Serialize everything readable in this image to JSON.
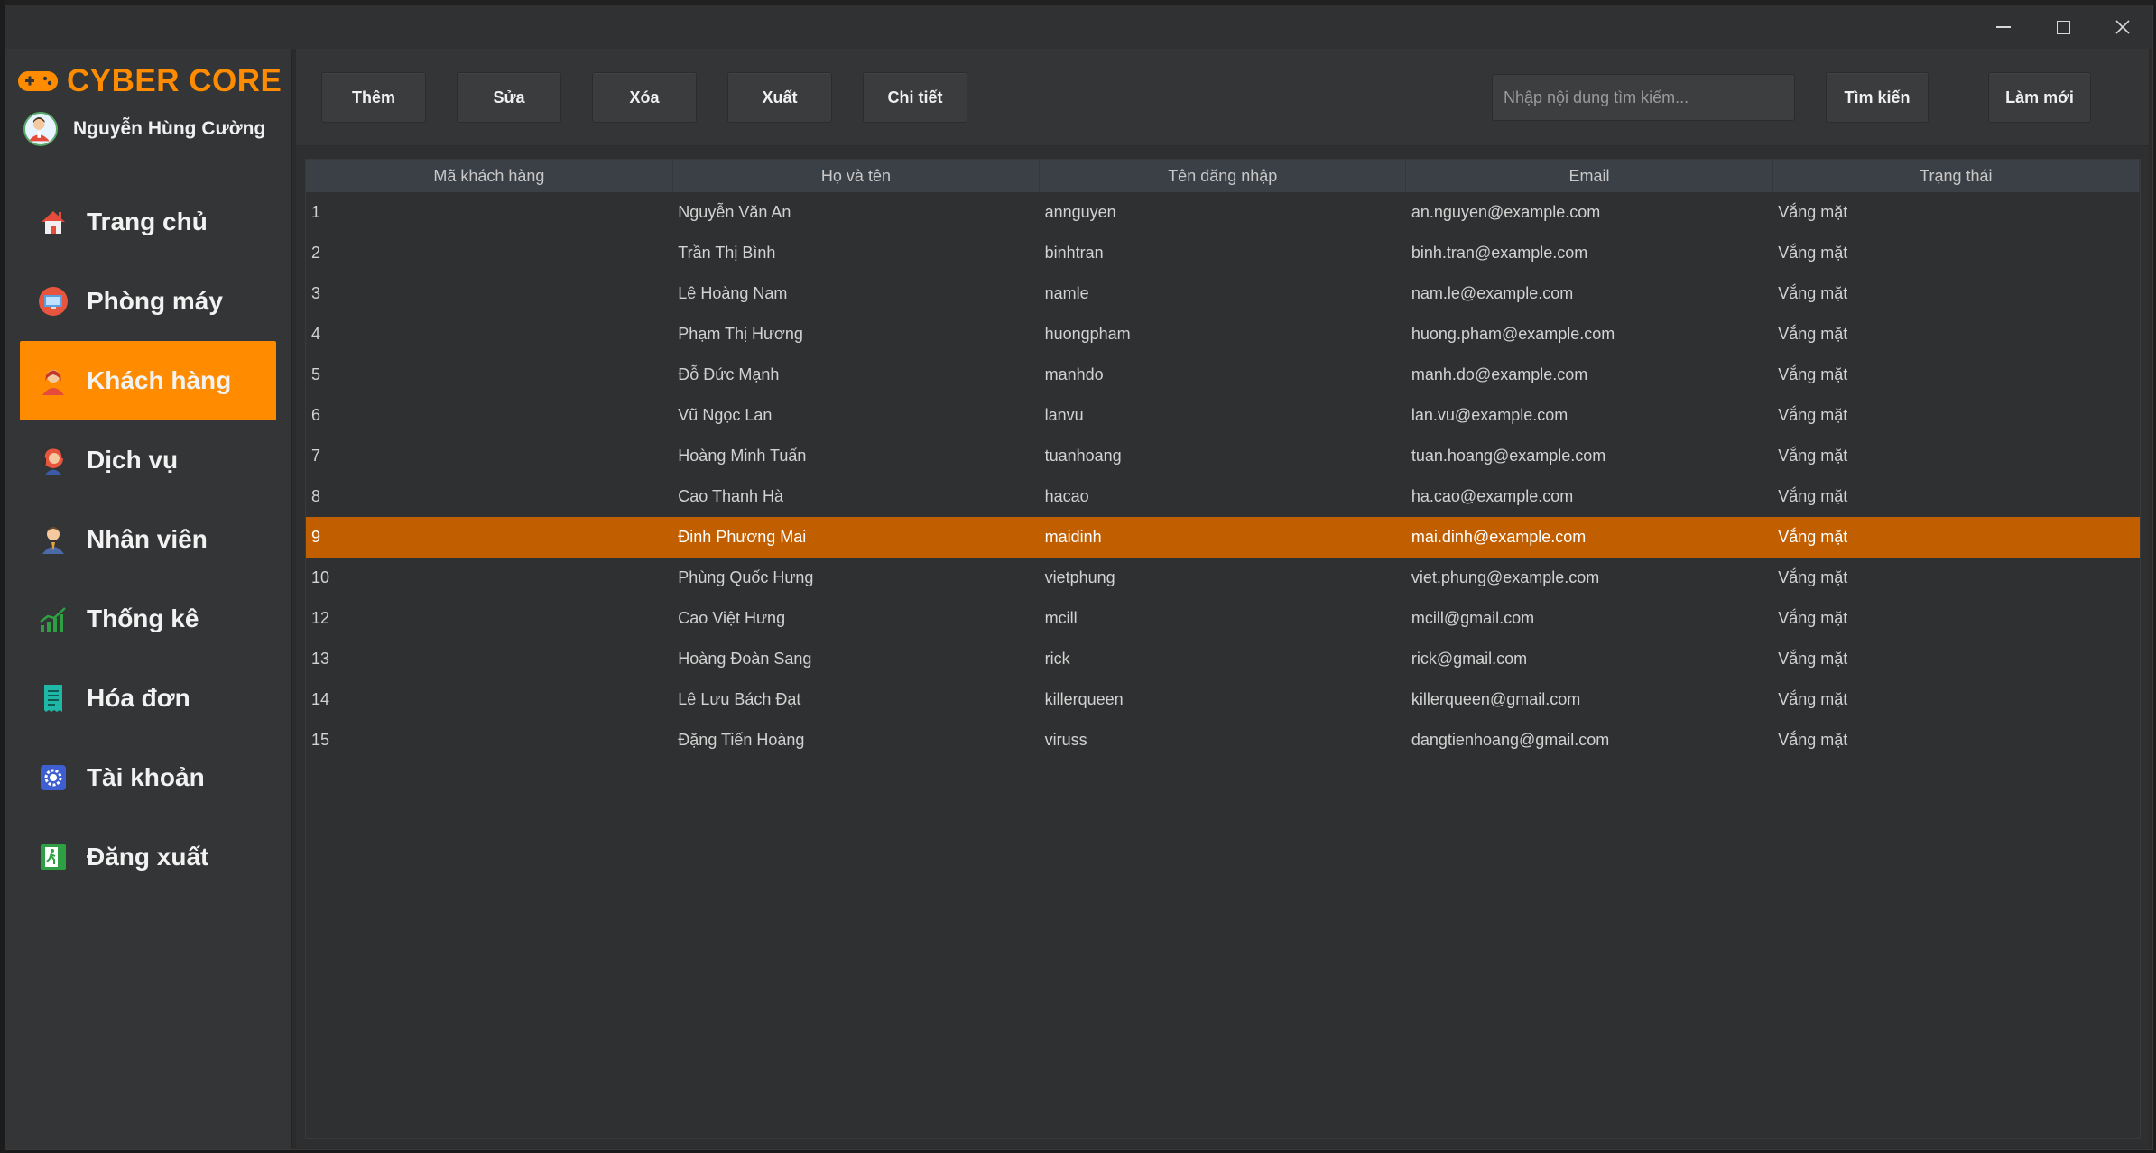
{
  "app": {
    "brand": "CYBER CORE",
    "user_name": "Nguyễn Hùng Cường",
    "accent_color": "#ff8c00",
    "selected_row_color": "#c15f00"
  },
  "nav": {
    "items": [
      {
        "label": "Trang chủ",
        "icon": "home-icon"
      },
      {
        "label": "Phòng máy",
        "icon": "computer-room-icon"
      },
      {
        "label": "Khách hàng",
        "icon": "customer-icon",
        "active": true
      },
      {
        "label": "Dịch vụ",
        "icon": "service-icon"
      },
      {
        "label": "Nhân viên",
        "icon": "employee-icon"
      },
      {
        "label": "Thống kê",
        "icon": "chart-icon"
      },
      {
        "label": "Hóa đơn",
        "icon": "invoice-icon"
      },
      {
        "label": "Tài khoản",
        "icon": "settings-icon"
      },
      {
        "label": "Đăng xuất",
        "icon": "logout-icon"
      }
    ]
  },
  "toolbar": {
    "add": "Thêm",
    "edit": "Sửa",
    "delete": "Xóa",
    "export": "Xuất",
    "detail": "Chi tiết",
    "search_placeholder": "Nhập nội dung tìm kiếm...",
    "search_button": "Tìm kiến",
    "refresh_button": "Làm mới"
  },
  "table": {
    "columns": [
      "Mã khách hàng",
      "Họ và tên",
      "Tên đăng nhập",
      "Email",
      "Trạng thái"
    ],
    "rows": [
      [
        "1",
        "Nguyễn Văn An",
        "annguyen",
        "an.nguyen@example.com",
        "Vắng mặt"
      ],
      [
        "2",
        "Trần Thị Bình",
        "binhtran",
        "binh.tran@example.com",
        "Vắng mặt"
      ],
      [
        "3",
        "Lê Hoàng Nam",
        "namle",
        "nam.le@example.com",
        "Vắng mặt"
      ],
      [
        "4",
        "Phạm Thị Hương",
        "huongpham",
        "huong.pham@example.com",
        "Vắng mặt"
      ],
      [
        "5",
        "Đỗ Đức Mạnh",
        "manhdo",
        "manh.do@example.com",
        "Vắng mặt"
      ],
      [
        "6",
        "Vũ Ngọc Lan",
        "lanvu",
        "lan.vu@example.com",
        "Vắng mặt"
      ],
      [
        "7",
        "Hoàng Minh Tuấn",
        "tuanhoang",
        "tuan.hoang@example.com",
        "Vắng mặt"
      ],
      [
        "8",
        "Cao Thanh Hà",
        "hacao",
        "ha.cao@example.com",
        "Vắng mặt"
      ],
      [
        "9",
        "Đinh Phương Mai",
        "maidinh",
        "mai.dinh@example.com",
        "Vắng mặt"
      ],
      [
        "10",
        "Phùng Quốc Hưng",
        "vietphung",
        "viet.phung@example.com",
        "Vắng mặt"
      ],
      [
        "12",
        "Cao Việt Hưng",
        "mcill",
        "mcill@gmail.com",
        "Vắng mặt"
      ],
      [
        "13",
        "Hoàng Đoàn Sang",
        "rick",
        "rick@gmail.com",
        "Vắng mặt"
      ],
      [
        "14",
        "Lê Lưu Bách Đạt",
        "killerqueen",
        "killerqueen@gmail.com",
        "Vắng mặt"
      ],
      [
        "15",
        "Đặng Tiến Hoàng",
        "viruss",
        "dangtienhoang@gmail.com",
        "Vắng mặt"
      ]
    ],
    "selected_row": 8
  }
}
